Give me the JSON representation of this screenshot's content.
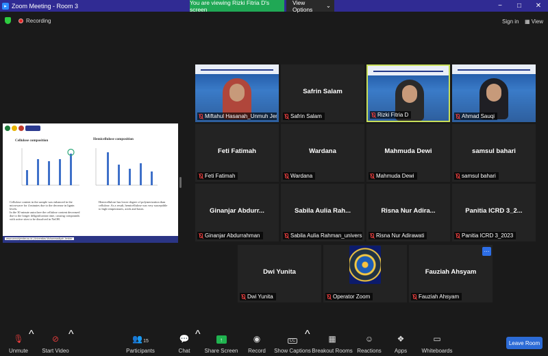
{
  "window": {
    "title": "Zoom Meeting - Room 3",
    "banner": "You are viewing Rizki Fitria D's screen",
    "view_options": "View Options",
    "minimize": "−",
    "maximize": "□",
    "close": "✕"
  },
  "header": {
    "recording": "Recording",
    "sign_in": "Sign in",
    "view": "View"
  },
  "slide": {
    "left_title": "Cellulose composition",
    "right_title": "Hemicellulose composition",
    "left_bullets": [
      "Cellulose content in the sample was enhanced in the microwave for 4 minutes due to the decrease in lignin levels.",
      "In the 30 minute autoclave the cellulose content decreased due to the longer delignification time, causing compounds with active sites to be dissolved in NaOH."
    ],
    "right_text": "Hemicellulose has lower degree of polymerization than cellulose. As a result, hemicellulose was very susceptible to high temperatures, acids and bases.",
    "footer": "www.unmuhjember.ac.id   |   Universitas Muhammadiyah Jember"
  },
  "participants": [
    {
      "name": "Miftahul Hasanah_Unmuh Jember",
      "big": "",
      "video": true,
      "active": false
    },
    {
      "name": "Safrin Salam",
      "big": "Safrin Salam",
      "video": false,
      "active": false
    },
    {
      "name": "Rizki Fitria D",
      "big": "",
      "video": true,
      "active": true
    },
    {
      "name": "Ahmad Sauqi",
      "big": "",
      "video": true,
      "active": false
    },
    {
      "name": "Feti Fatimah",
      "big": "Feti Fatimah",
      "video": false,
      "active": false
    },
    {
      "name": "Wardana",
      "big": "Wardana",
      "video": false,
      "active": false
    },
    {
      "name": "Mahmuda Dewi",
      "big": "Mahmuda Dewi",
      "video": false,
      "active": false
    },
    {
      "name": "samsul bahari",
      "big": "samsul bahari",
      "video": false,
      "active": false
    },
    {
      "name": "Ginanjar Abdurrahman",
      "big": "Ginanjar  Abdurr...",
      "video": false,
      "active": false
    },
    {
      "name": "Sabila Aulia Rahman_universit...",
      "big": "Sabila Aulia Rah...",
      "video": false,
      "active": false
    },
    {
      "name": "Risna Nur Adirawati",
      "big": "Risna Nur Adira...",
      "video": false,
      "active": false
    },
    {
      "name": "Panitia ICRD 3_2023",
      "big": "Panitia ICRD 3_2...",
      "video": false,
      "active": false
    },
    {
      "name": "Dwi Yunita",
      "big": "Dwi Yunita",
      "video": false,
      "active": false
    },
    {
      "name": "Operator Zoom",
      "big": "",
      "video": false,
      "active": false
    },
    {
      "name": "Fauziah Ahsyam",
      "big": "Fauziah Ahsyam",
      "video": false,
      "active": false
    }
  ],
  "toolbar": {
    "unmute": "Unmute",
    "stop_video": "Start Video",
    "participants": "Participants",
    "participants_count": "15",
    "chat": "Chat",
    "share_screen": "Share Screen",
    "record": "Record",
    "show_captions": "Show Captions",
    "breakout_rooms": "Breakout Rooms",
    "reactions": "Reactions",
    "apps": "Apps",
    "whiteboards": "Whiteboards",
    "leave": "Leave Room",
    "more": "···"
  },
  "colors": {
    "titlebar": "#302b93",
    "banner": "#20a855",
    "active_border": "#c9e05a",
    "leave": "#2c6bd6"
  }
}
